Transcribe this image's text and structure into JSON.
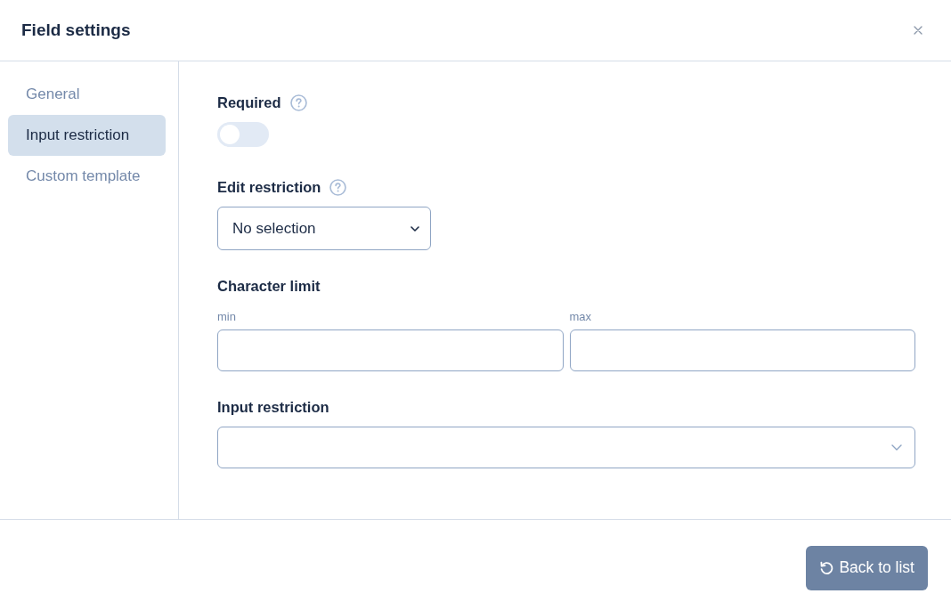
{
  "dialog": {
    "title": "Field settings"
  },
  "sidebar": {
    "items": [
      {
        "label": "General",
        "selected": false
      },
      {
        "label": "Input restriction",
        "selected": true
      },
      {
        "label": "Custom template",
        "selected": false
      }
    ]
  },
  "fields": [
    {
      "kind": "toggle",
      "label": "Required",
      "help": true,
      "on": false
    },
    {
      "kind": "select",
      "label": "Edit restriction",
      "help": true,
      "value": "No selection"
    },
    {
      "kind": "range",
      "label": "Character limit",
      "help": false,
      "inputs": [
        {
          "label": "min"
        },
        {
          "label": "max"
        }
      ]
    },
    {
      "kind": "combobox",
      "label": "Input restriction",
      "help": false
    }
  ],
  "footer": {
    "button": "Back to list"
  }
}
